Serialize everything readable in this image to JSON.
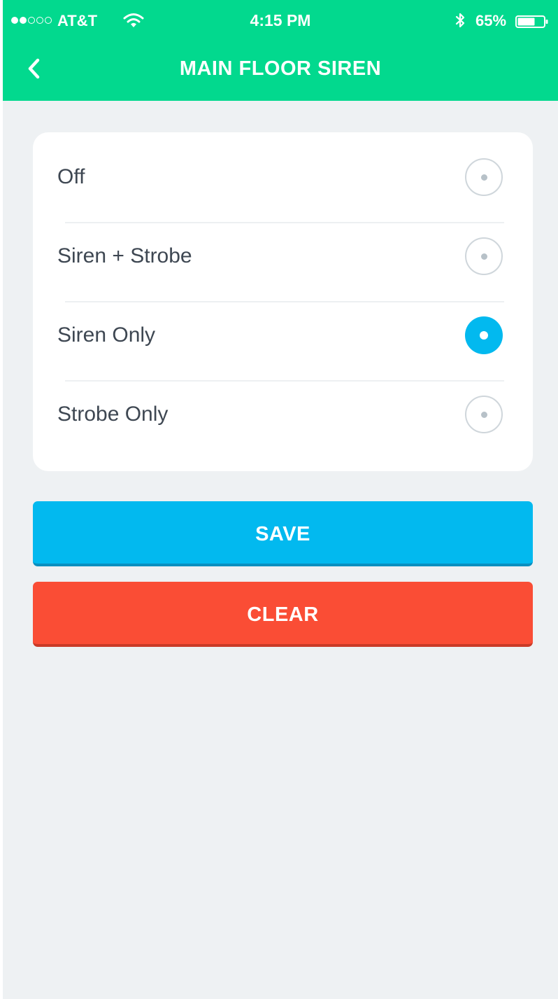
{
  "status_bar": {
    "carrier": "AT&T",
    "time": "4:15 PM",
    "battery_percent": "65%",
    "signal_bars": 2,
    "signal_bars_max": 5
  },
  "header": {
    "title": "MAIN FLOOR SIREN",
    "back_icon": "chevron-left-icon"
  },
  "options": [
    {
      "label": "Off",
      "selected": false
    },
    {
      "label": "Siren + Strobe",
      "selected": false
    },
    {
      "label": "Siren Only",
      "selected": true
    },
    {
      "label": "Strobe Only",
      "selected": false
    }
  ],
  "actions": {
    "save_label": "SAVE",
    "clear_label": "CLEAR"
  },
  "colors": {
    "header_bg": "#02d98e",
    "background": "#eef1f3",
    "accent": "#02b9ef",
    "danger": "#fa4d35",
    "text": "#3e4752"
  }
}
